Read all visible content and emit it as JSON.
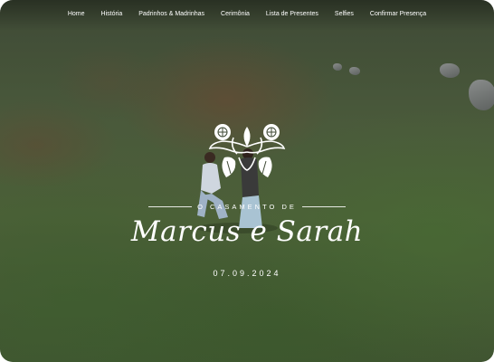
{
  "nav": {
    "items": [
      {
        "label": "Home"
      },
      {
        "label": "História"
      },
      {
        "label": "Padrinhos & Madrinhas"
      },
      {
        "label": "Cerimônia"
      },
      {
        "label": "Lista de Presentes"
      },
      {
        "label": "Selfies"
      },
      {
        "label": "Confirmar Presença"
      }
    ]
  },
  "hero": {
    "subtitle": "O CASAMENTO DE",
    "names": "Marcus e Sarah",
    "date": "07.09.2024"
  },
  "colors": {
    "text": "#ffffff",
    "grass": "#4c6038",
    "dirt": "#6e4632"
  },
  "icons": {
    "emblem": "floral-ornament-icon"
  }
}
